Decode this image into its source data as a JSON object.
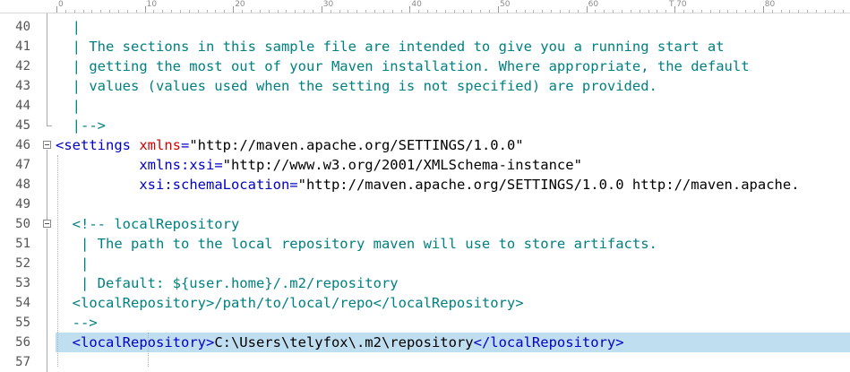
{
  "ruler": {
    "labels": [
      "0",
      "10",
      "20",
      "30",
      "40",
      "50",
      "60",
      "70",
      "80"
    ],
    "tab_marker": "T"
  },
  "lines": [
    {
      "num": "40",
      "tokens": [
        {
          "t": "comment",
          "v": "  |"
        }
      ]
    },
    {
      "num": "41",
      "tokens": [
        {
          "t": "comment",
          "v": "  | The sections in this sample file are intended to give you a running start at"
        }
      ]
    },
    {
      "num": "42",
      "tokens": [
        {
          "t": "comment",
          "v": "  | getting the most out of your Maven installation. Where appropriate, the default"
        }
      ]
    },
    {
      "num": "43",
      "tokens": [
        {
          "t": "comment",
          "v": "  | values (values used when the setting is not specified) are provided."
        }
      ]
    },
    {
      "num": "44",
      "tokens": [
        {
          "t": "comment",
          "v": "  |"
        }
      ]
    },
    {
      "num": "45",
      "tokens": [
        {
          "t": "comment",
          "v": "  |-->"
        }
      ]
    },
    {
      "num": "46",
      "tokens": [
        {
          "t": "tag",
          "v": "<settings "
        },
        {
          "t": "attr",
          "v": "xmlns"
        },
        {
          "t": "tag",
          "v": "="
        },
        {
          "t": "val",
          "v": "\"http://maven.apache.org/SETTINGS/1.0.0\""
        }
      ]
    },
    {
      "num": "47",
      "tokens": [
        {
          "t": "text",
          "v": "          "
        },
        {
          "t": "tag",
          "v": "xmlns:xsi="
        },
        {
          "t": "val",
          "v": "\"http://www.w3.org/2001/XMLSchema-instance\""
        }
      ]
    },
    {
      "num": "48",
      "tokens": [
        {
          "t": "text",
          "v": "          "
        },
        {
          "t": "tag",
          "v": "xsi:schemaLocation="
        },
        {
          "t": "val",
          "v": "\"http://maven.apache.org/SETTINGS/1.0.0 http://maven.apache."
        }
      ]
    },
    {
      "num": "49",
      "tokens": []
    },
    {
      "num": "50",
      "tokens": [
        {
          "t": "text",
          "v": "  "
        },
        {
          "t": "comment",
          "v": "<!-- localRepository"
        }
      ]
    },
    {
      "num": "51",
      "tokens": [
        {
          "t": "comment",
          "v": "   | The path to the local repository maven will use to store artifacts."
        }
      ]
    },
    {
      "num": "52",
      "tokens": [
        {
          "t": "comment",
          "v": "   |"
        }
      ]
    },
    {
      "num": "53",
      "tokens": [
        {
          "t": "comment",
          "v": "   | Default: ${user.home}/.m2/repository"
        }
      ]
    },
    {
      "num": "54",
      "tokens": [
        {
          "t": "comment",
          "v": "  <localRepository>/path/to/local/repo</localRepository>"
        }
      ]
    },
    {
      "num": "55",
      "tokens": [
        {
          "t": "comment",
          "v": "  -->"
        }
      ]
    },
    {
      "num": "56",
      "tokens": [
        {
          "t": "text",
          "v": "  "
        },
        {
          "t": "tag",
          "v": "<localRepository>"
        },
        {
          "t": "text",
          "v": "C:\\Users\\telyfox\\.m2\\repository"
        },
        {
          "t": "tag",
          "v": "</localRepository>"
        }
      ],
      "highlighted": true
    },
    {
      "num": "57",
      "tokens": []
    }
  ],
  "colors": {
    "comment": "#008080",
    "tag": "#0000c8",
    "attribute": "#d40000",
    "current_line": "#bfdef0"
  }
}
